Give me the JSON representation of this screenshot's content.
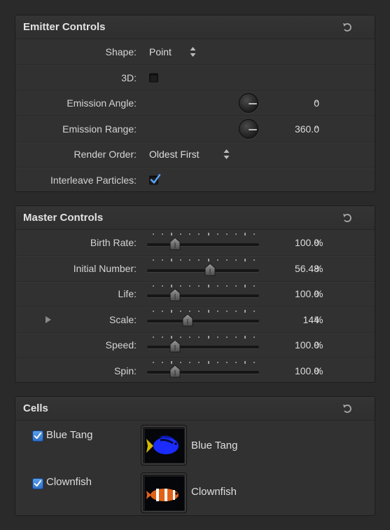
{
  "emitter": {
    "title": "Emitter Controls",
    "shape_label": "Shape:",
    "shape_value": "Point",
    "threeD_label": "3D:",
    "angle_label": "Emission Angle:",
    "angle_value": "0",
    "range_label": "Emission Range:",
    "range_value": "360.0",
    "degree_unit": "°",
    "order_label": "Render Order:",
    "order_value": "Oldest First",
    "interleave_label": "Interleave Particles:",
    "threeD_checked": false,
    "interleave_checked": true
  },
  "master": {
    "title": "Master Controls",
    "rows": [
      {
        "label": "Birth Rate:",
        "value": "100.0",
        "unit": "%",
        "level": 0.25
      },
      {
        "label": "Initial Number:",
        "value": "56.48",
        "unit": "%",
        "level": 0.565
      },
      {
        "label": "Life:",
        "value": "100.0",
        "unit": "%",
        "level": 0.25
      },
      {
        "label": "Scale:",
        "value": "144",
        "unit": "%",
        "level": 0.36
      },
      {
        "label": "Speed:",
        "value": "100.0",
        "unit": "%",
        "level": 0.25
      },
      {
        "label": "Spin:",
        "value": "100.0",
        "unit": "%",
        "level": 0.25
      }
    ]
  },
  "cells": {
    "title": "Cells",
    "items": [
      {
        "name": "Blue Tang",
        "thumb_label": "Blue Tang",
        "checked": true
      },
      {
        "name": "Clownfish",
        "thumb_label": "Clownfish",
        "checked": true
      }
    ]
  },
  "icons": {
    "reset": "reset-arrow-icon",
    "updown": "up-down-arrows-icon",
    "checkmark": "checkmark-icon",
    "disclosure": "disclosure-triangle-icon"
  },
  "colors": {
    "panel_bg": "#313131",
    "page_bg": "#2a2a2a",
    "checkbox_accent": "#3a7fd6"
  }
}
